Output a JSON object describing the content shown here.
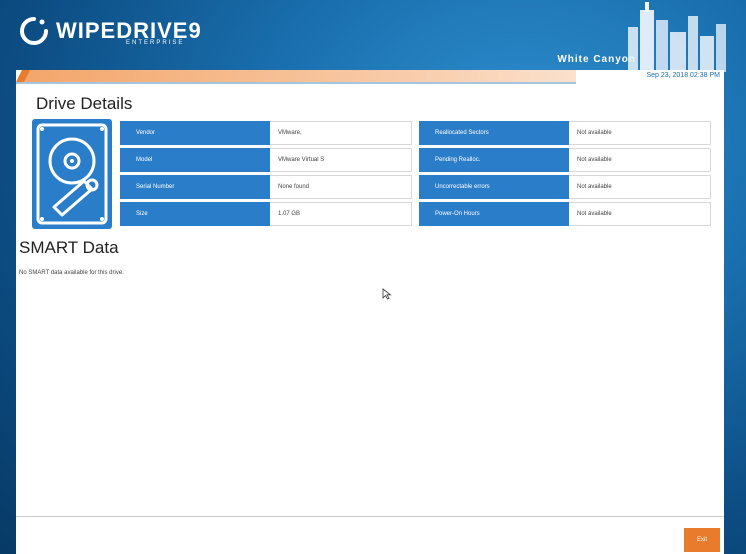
{
  "header": {
    "brand": "WIPEDRIVE9",
    "edition": "ENTERPRISE",
    "company": "White Canyon",
    "datetime": "Sep 23, 2018 02:38 PM"
  },
  "drive_details": {
    "title": "Drive Details",
    "left_rows": [
      {
        "label": "Vendor",
        "value": "VMware,"
      },
      {
        "label": "Model",
        "value": "VMware Virtual S"
      },
      {
        "label": "Serial Number",
        "value": "None found"
      },
      {
        "label": "Size",
        "value": "1.07 GB"
      }
    ],
    "right_rows": [
      {
        "label": "Reallocated Sectors",
        "value": "Not available"
      },
      {
        "label": "Pending Realloc.",
        "value": "Not available"
      },
      {
        "label": "Uncorrectable errors",
        "value": "Not available"
      },
      {
        "label": "Power-On Hours",
        "value": "Not available"
      }
    ]
  },
  "smart": {
    "title": "SMART Data",
    "message": "No SMART data available for this drive."
  },
  "footer": {
    "exit_label": "Exit"
  },
  "colors": {
    "primary_blue": "#2a7dc8",
    "accent_orange": "#e87c2c"
  }
}
